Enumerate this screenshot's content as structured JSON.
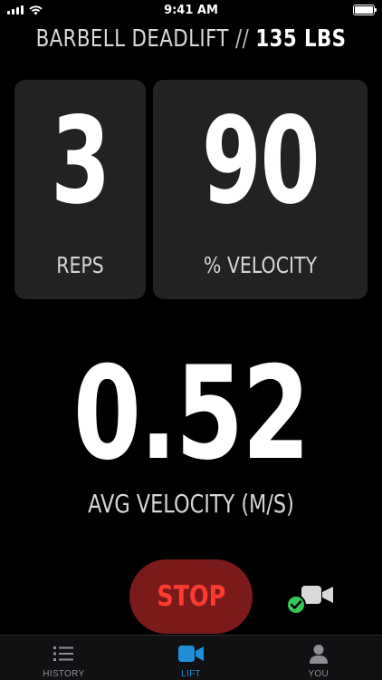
{
  "status_bar": {
    "time": "9:41 AM"
  },
  "header": {
    "exercise": "BARBELL DEADLIFT",
    "separator": " // ",
    "weight": "135 LBS"
  },
  "stats": {
    "reps": {
      "value": "3",
      "label": "REPS"
    },
    "velocity_percent": {
      "value": "90",
      "label": "% VELOCITY"
    }
  },
  "avg_velocity": {
    "value": "0.52",
    "label": "AVG VELOCITY (M/S)"
  },
  "controls": {
    "stop_label": "STOP",
    "camera_icon": "video-camera-icon",
    "camera_status_icon": "checkmark-icon"
  },
  "tabs": [
    {
      "label": "HISTORY",
      "icon": "list-icon",
      "active": false
    },
    {
      "label": "LIFT",
      "icon": "video-camera-icon",
      "active": true
    },
    {
      "label": "YOU",
      "icon": "person-icon",
      "active": false
    }
  ],
  "colors": {
    "background": "#000000",
    "card": "#222224",
    "stop_fill": "#7a1a1a",
    "stop_text": "#ff3b30",
    "accent_blue": "#1e8fd6",
    "check_green": "#34c759",
    "inactive_tab": "#8e8e93"
  }
}
